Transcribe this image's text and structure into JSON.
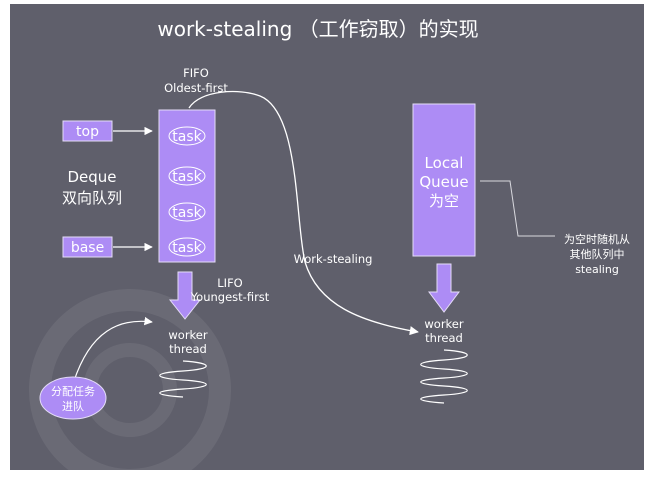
{
  "title": "work-stealing （工作窃取）的实现",
  "fifo_label": {
    "line1": "FIFO",
    "line2": "Oldest-first"
  },
  "lifo_label": {
    "line1": "LIFO",
    "line2": "Youngest-first"
  },
  "deque_label": {
    "line1": "Deque",
    "line2": "双向队列"
  },
  "pointers": {
    "top": "top",
    "base": "base"
  },
  "deque_tasks": [
    "task",
    "task",
    "task",
    "task"
  ],
  "local_queue": {
    "line1": "Local",
    "line2": "Queue",
    "line3": "为空"
  },
  "steal_note": {
    "line1": "为空时随机从",
    "line2": "其他队列中",
    "line3": "stealing"
  },
  "work_stealing_label": "Work-stealing",
  "worker_left": {
    "line1": "worker",
    "line2": "thread"
  },
  "worker_right": {
    "line1": "worker",
    "line2": "thread"
  },
  "enqueue_bubble": {
    "line1": "分配任务",
    "line2": "进队"
  },
  "colors": {
    "slide_bg": "#5f5f6b",
    "box_fill": "#ad8cf5",
    "box_border": "#e4dcf8",
    "text": "#ffffff",
    "line": "#ffffff"
  }
}
